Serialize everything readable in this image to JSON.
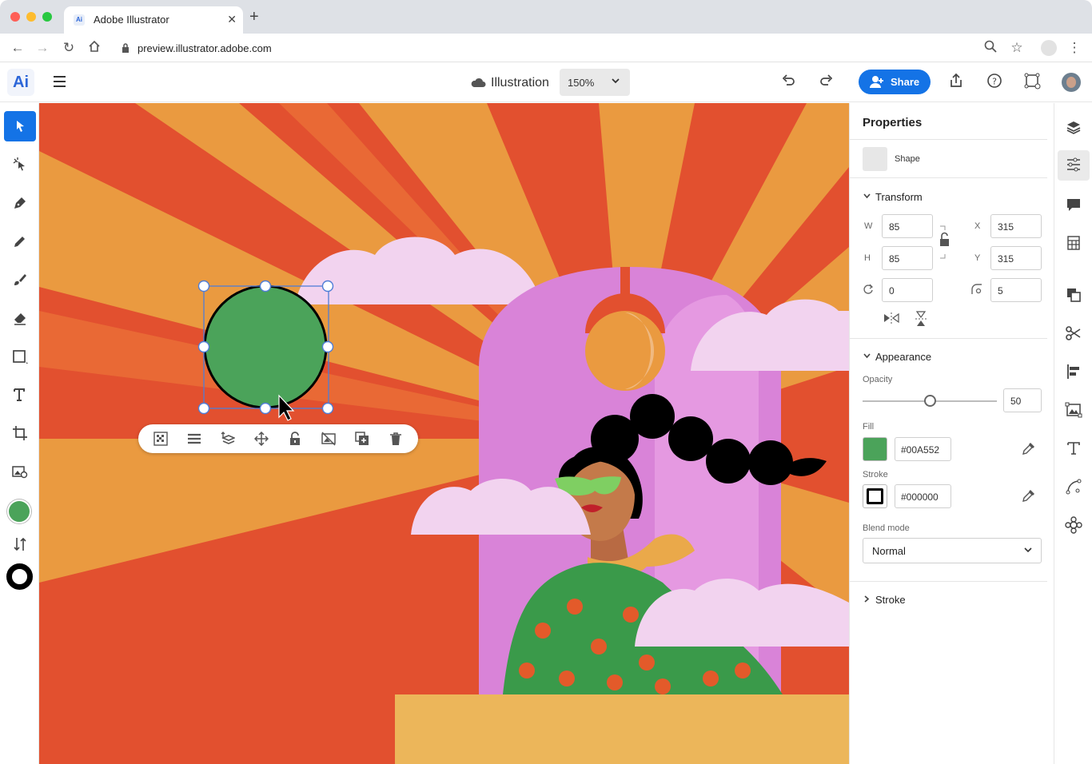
{
  "browser": {
    "tab_title": "Adobe Illustrator",
    "tab_favicon": "Ai",
    "url": "preview.illustrator.adobe.com"
  },
  "app": {
    "logo": "Ai",
    "document_title": "Illustration",
    "zoom": "150%",
    "share_label": "Share"
  },
  "left_tools": [
    "selection-tool",
    "direct-selection-tool",
    "pen-tool",
    "pencil-tool",
    "paintbrush-tool",
    "eraser-tool",
    "rectangle-tool",
    "type-tool",
    "crop-tool",
    "place-image-tool"
  ],
  "context_bar": [
    "transparency-icon",
    "align-icon",
    "arrange-icon",
    "move-icon",
    "lock-icon",
    "mask-icon",
    "duplicate-icon",
    "delete-icon"
  ],
  "properties": {
    "title": "Properties",
    "selection_type": "Shape",
    "transform": {
      "header": "Transform",
      "w_label": "W",
      "w": "85",
      "h_label": "H",
      "h": "85",
      "x_label": "X",
      "x": "315",
      "y_label": "Y",
      "y": "315",
      "rotation": "0",
      "corner_radius": "5"
    },
    "appearance": {
      "header": "Appearance",
      "opacity_label": "Opacity",
      "opacity": "50",
      "opacity_level": 0.5,
      "fill_label": "Fill",
      "fill_hex": "#00A552",
      "fill_color": "#4ba35a",
      "stroke_label": "Stroke",
      "stroke_hex": "#000000",
      "blend_label": "Blend mode",
      "blend_mode": "Normal"
    },
    "stroke_section": "Stroke"
  },
  "right_rail": [
    "layers-icon",
    "properties-icon",
    "comments-icon",
    "libraries-icon",
    "pathfinder-icon",
    "scissors-icon",
    "align-panel-icon",
    "image-trace-icon",
    "type-panel-icon",
    "curvature-icon",
    "symbols-icon"
  ],
  "colors": {
    "accent": "#1473e6",
    "canvas_bg": "#e2502f",
    "selected_fill": "#4ba35a"
  }
}
